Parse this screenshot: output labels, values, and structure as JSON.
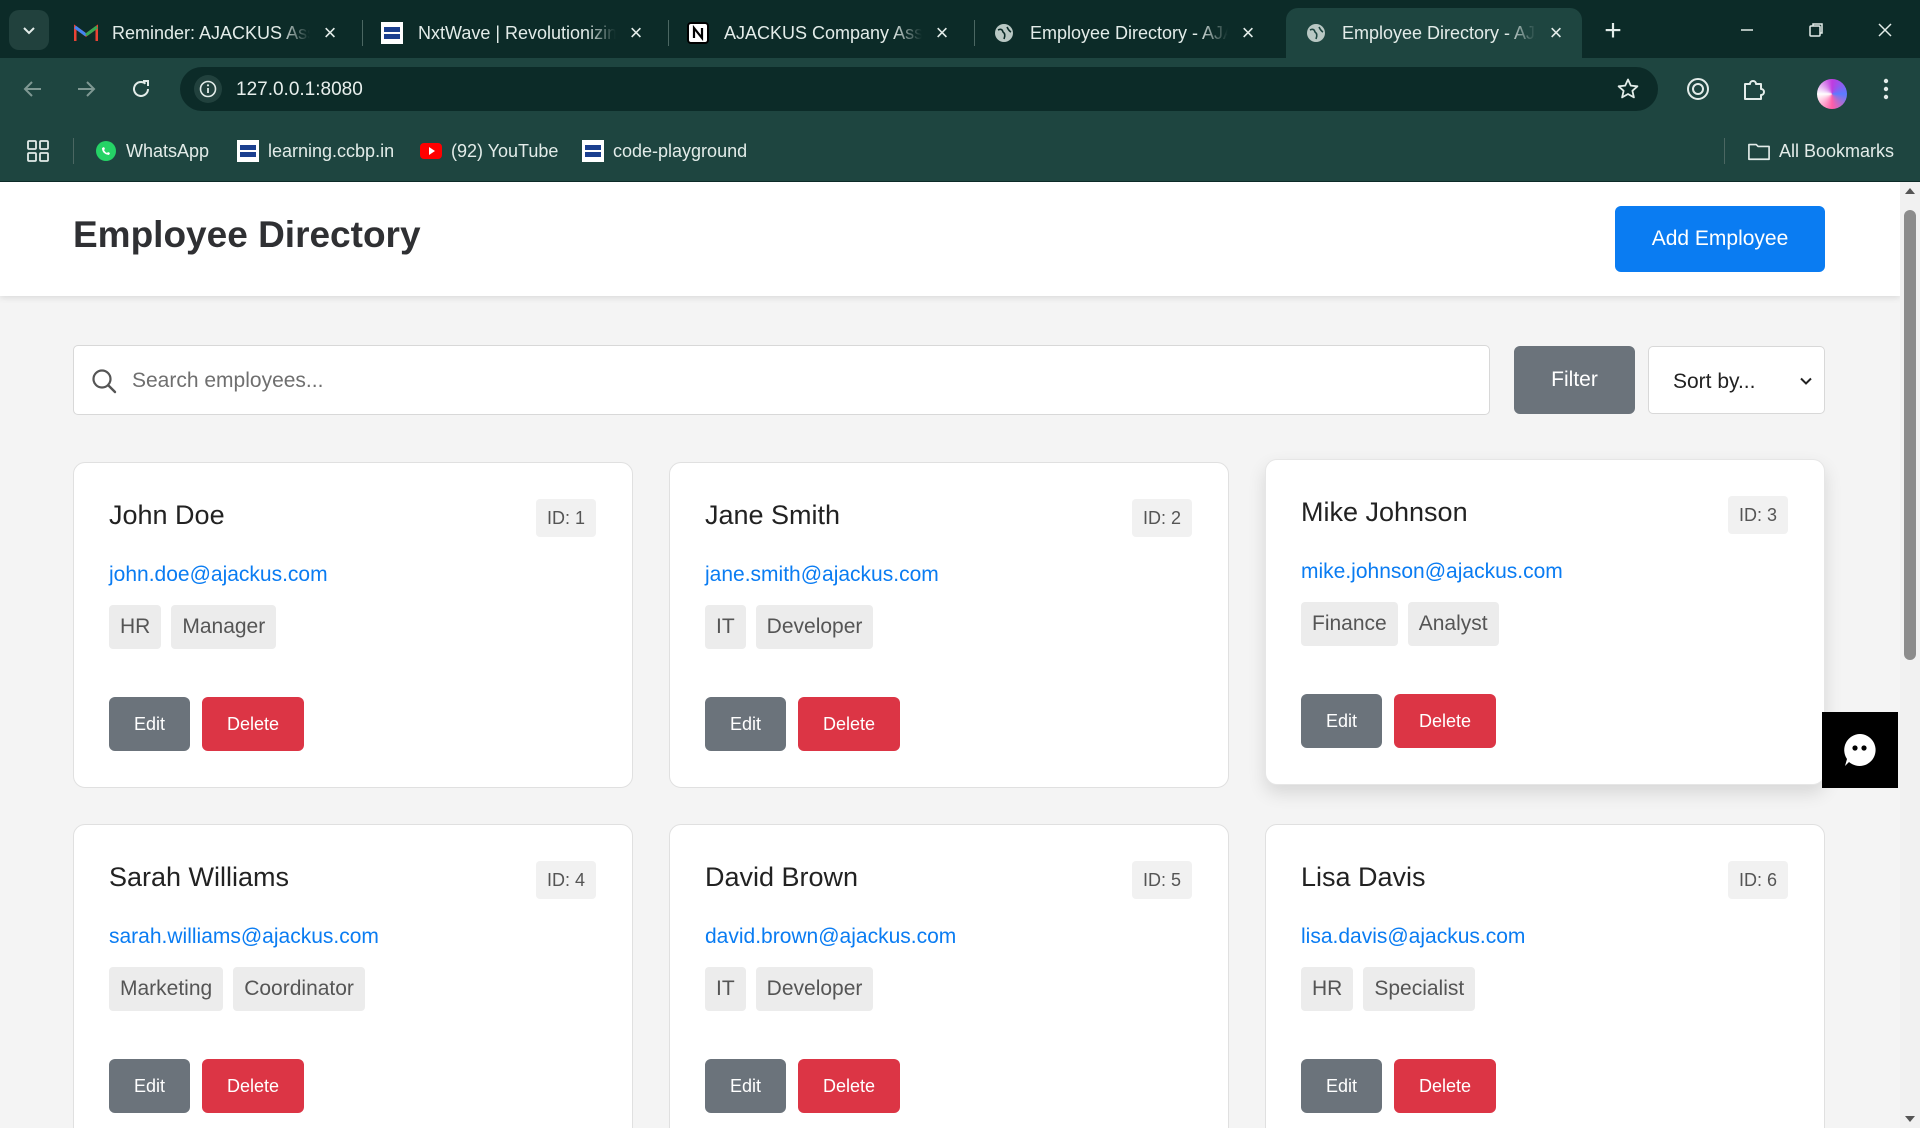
{
  "browser": {
    "tabs": [
      {
        "title": "Reminder: AJACKUS Assignment",
        "icon": "gmail-icon"
      },
      {
        "title": "NxtWave | Revolutionizing",
        "icon": "nxtwave-icon"
      },
      {
        "title": "AJACKUS Company Assignment",
        "icon": "notion-icon"
      },
      {
        "title": "Employee Directory - AJACKUS",
        "icon": "globe-icon"
      },
      {
        "title": "Employee Directory - AJACKUS",
        "icon": "globe-icon"
      }
    ],
    "address": "127.0.0.1:8080",
    "bookmarks": [
      {
        "label": "WhatsApp",
        "icon": "whatsapp-icon"
      },
      {
        "label": "learning.ccbp.in",
        "icon": "nxtwave-icon"
      },
      {
        "label": "(92) YouTube",
        "icon": "youtube-icon"
      },
      {
        "label": "code-playground",
        "icon": "nxtwave-icon"
      }
    ],
    "all_bookmarks_label": "All Bookmarks"
  },
  "page": {
    "title": "Employee Directory",
    "add_button": "Add Employee",
    "search_placeholder": "Search employees...",
    "filter_button": "Filter",
    "sort_label": "Sort by..."
  },
  "employees": [
    {
      "name": "John Doe",
      "id": "ID: 1",
      "email": "john.doe@ajackus.com",
      "department": "HR",
      "role": "Manager"
    },
    {
      "name": "Jane Smith",
      "id": "ID: 2",
      "email": "jane.smith@ajackus.com",
      "department": "IT",
      "role": "Developer"
    },
    {
      "name": "Mike Johnson",
      "id": "ID: 3",
      "email": "mike.johnson@ajackus.com",
      "department": "Finance",
      "role": "Analyst"
    },
    {
      "name": "Sarah Williams",
      "id": "ID: 4",
      "email": "sarah.williams@ajackus.com",
      "department": "Marketing",
      "role": "Coordinator"
    },
    {
      "name": "David Brown",
      "id": "ID: 5",
      "email": "david.brown@ajackus.com",
      "department": "IT",
      "role": "Developer"
    },
    {
      "name": "Lisa Davis",
      "id": "ID: 6",
      "email": "lisa.davis@ajackus.com",
      "department": "HR",
      "role": "Specialist"
    }
  ],
  "card_actions": {
    "edit": "Edit",
    "delete": "Delete"
  },
  "colors": {
    "primary": "#0a7cf2",
    "danger": "#dc3545",
    "secondary": "#6b737b",
    "chrome": "#1e4540"
  }
}
